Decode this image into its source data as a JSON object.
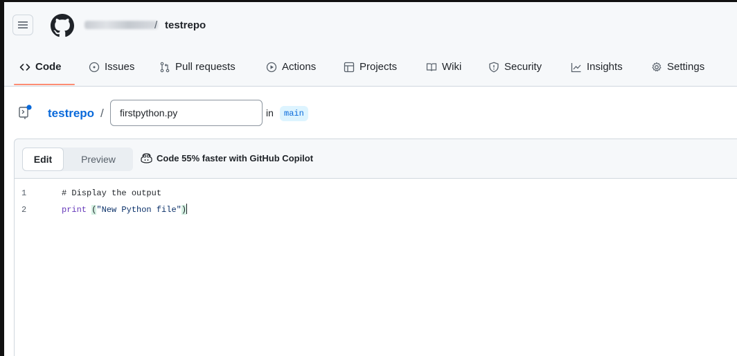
{
  "header": {
    "menu_icon": "hamburger-icon",
    "logo_icon": "github-mark-icon",
    "separator": "/",
    "repo": "testrepo"
  },
  "tabs": [
    {
      "label": "Code",
      "icon": "code-icon",
      "active": true
    },
    {
      "label": "Issues",
      "icon": "issue-opened-icon"
    },
    {
      "label": "Pull requests",
      "icon": "git-pull-request-icon"
    },
    {
      "label": "Actions",
      "icon": "play-icon"
    },
    {
      "label": "Projects",
      "icon": "table-icon"
    },
    {
      "label": "Wiki",
      "icon": "book-icon"
    },
    {
      "label": "Security",
      "icon": "shield-icon"
    },
    {
      "label": "Insights",
      "icon": "graph-icon"
    },
    {
      "label": "Settings",
      "icon": "gear-icon"
    }
  ],
  "colors": {
    "accent": "#fd8c73",
    "link": "#0969da",
    "branch_bg": "#ddf4ff"
  },
  "file": {
    "repo_link": "testrepo",
    "slash": "/",
    "filename": "firstpython.py",
    "in_label": "in",
    "branch": "main"
  },
  "editor_toolbar": {
    "edit_label": "Edit",
    "preview_label": "Preview",
    "copilot_text": "Code 55% faster with GitHub Copilot"
  },
  "editor": {
    "lines": [
      {
        "number": "1",
        "text": "# Display the output"
      },
      {
        "number": "2",
        "fn": "print ",
        "open": "(",
        "str": "\"New Python file\"",
        "close": ")"
      }
    ]
  }
}
